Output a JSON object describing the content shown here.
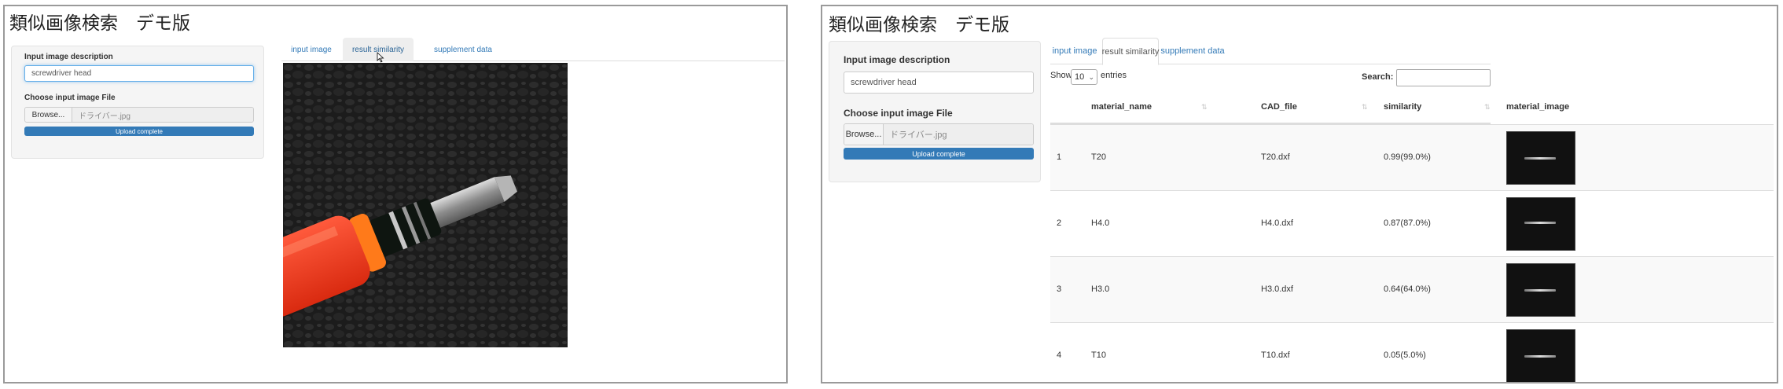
{
  "left": {
    "title": "類似画像検索　デモ版",
    "description_label": "Input image description",
    "description_value": "screwdriver head",
    "file_label": "Choose input image File",
    "browse_label": "Browse...",
    "file_name": "ドライバー.jpg",
    "upload_status": "Upload complete",
    "upload_progress_percent": 100,
    "tabs": [
      {
        "label": "input image",
        "active": true
      },
      {
        "label": "result similarity",
        "active": false,
        "hovered": true
      },
      {
        "label": "supplement data",
        "active": false
      }
    ]
  },
  "right": {
    "title": "類似画像検索　デモ版",
    "description_label": "Input image description",
    "description_value": "screwdriver head",
    "file_label": "Choose input image File",
    "browse_label": "Browse...",
    "file_name": "ドライバー.jpg",
    "upload_status": "Upload complete",
    "upload_progress_percent": 100,
    "tabs": [
      {
        "label": "input image",
        "active": false
      },
      {
        "label": "result similarity",
        "active": true
      },
      {
        "label": "supplement data",
        "active": false
      }
    ],
    "show_label": "Show",
    "entries_value": "10",
    "entries_label": "entries",
    "search_label": "Search:",
    "columns": [
      "",
      "material_name",
      "CAD_file",
      "similarity",
      "material_image"
    ],
    "rows": [
      {
        "index": "1",
        "material_name": "T20",
        "cad_file": "T20.dxf",
        "similarity": "0.99(99.0%)"
      },
      {
        "index": "2",
        "material_name": "H4.0",
        "cad_file": "H4.0.dxf",
        "similarity": "0.87(87.0%)"
      },
      {
        "index": "3",
        "material_name": "H3.0",
        "cad_file": "H3.0.dxf",
        "similarity": "0.64(64.0%)"
      },
      {
        "index": "4",
        "material_name": "T10",
        "cad_file": "T10.dxf",
        "similarity": "0.05(5.0%)"
      }
    ]
  },
  "colors": {
    "primary": "#337ab7",
    "tab_link": "#337ab7",
    "well_bg": "#f5f5f5",
    "row_stripe": "#f9f9f9",
    "handle_red": "#f0391f",
    "handle_orange": "#ff7a1a"
  }
}
